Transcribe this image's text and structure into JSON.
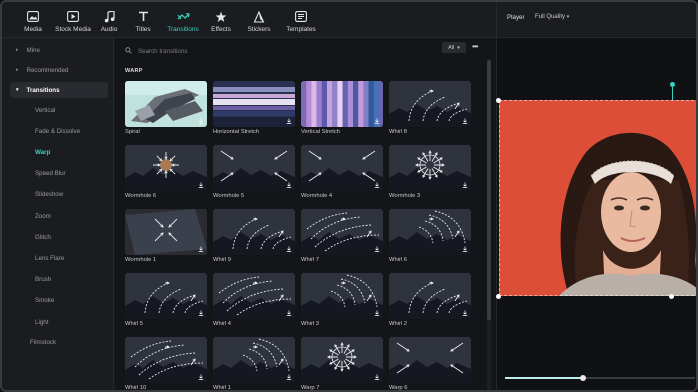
{
  "toolbar": {
    "items": [
      {
        "label": "Media",
        "icon": "media-icon"
      },
      {
        "label": "Stock Media",
        "icon": "stock-media-icon"
      },
      {
        "label": "Audio",
        "icon": "audio-icon"
      },
      {
        "label": "Titles",
        "icon": "titles-icon"
      },
      {
        "label": "Transitions",
        "icon": "transitions-icon",
        "active": true
      },
      {
        "label": "Effects",
        "icon": "effects-icon"
      },
      {
        "label": "Stickers",
        "icon": "stickers-icon"
      },
      {
        "label": "Templates",
        "icon": "templates-icon"
      }
    ]
  },
  "sidebar": {
    "mine": "Mine",
    "recommended": "Recommended",
    "transitions": "Transitions",
    "items": [
      "Vertical",
      "Fade & Dissolve",
      "Warp",
      "Speed Blur",
      "Slideshow",
      "Zoom",
      "Glitch",
      "Lens Flare",
      "Brush",
      "Smoke",
      "Light"
    ],
    "active_item": "Warp",
    "filmstock": "Filmstock"
  },
  "content": {
    "search_placeholder": "Search transitions",
    "filter": "All",
    "section": "WARP",
    "tiles": [
      {
        "name": "Spiral",
        "kind": "spiral"
      },
      {
        "name": "Horizontal Stretch",
        "kind": "hstretch"
      },
      {
        "name": "Vertical Stretch",
        "kind": "vstretch"
      },
      {
        "name": "Whirl 8",
        "kind": "whirl"
      },
      {
        "name": "Wormhole 6",
        "kind": "wormhole"
      },
      {
        "name": "Wormhole 5",
        "kind": "diag"
      },
      {
        "name": "Wormhole 4",
        "kind": "diag"
      },
      {
        "name": "Wormhole 3",
        "kind": "radial"
      },
      {
        "name": "Wormhole 1",
        "kind": "tilt"
      },
      {
        "name": "Whirl 9",
        "kind": "whirl"
      },
      {
        "name": "Whirl 7",
        "kind": "whirl"
      },
      {
        "name": "Whirl 6",
        "kind": "whirl"
      },
      {
        "name": "Whirl 5",
        "kind": "whirl"
      },
      {
        "name": "Whirl 4",
        "kind": "whirl"
      },
      {
        "name": "Whirl 3",
        "kind": "whirl"
      },
      {
        "name": "Whirl 2",
        "kind": "whirl"
      },
      {
        "name": "Whirl 10",
        "kind": "whirl"
      },
      {
        "name": "Whirl 1",
        "kind": "whirl"
      },
      {
        "name": "Warp 7",
        "kind": "radial"
      },
      {
        "name": "Warp 6",
        "kind": "diag"
      }
    ]
  },
  "player": {
    "label": "Player",
    "quality": "Full Quality",
    "playback_fraction": 0.41
  },
  "colors": {
    "accent": "#3ad0c2",
    "video_bg": "#e0503a"
  }
}
